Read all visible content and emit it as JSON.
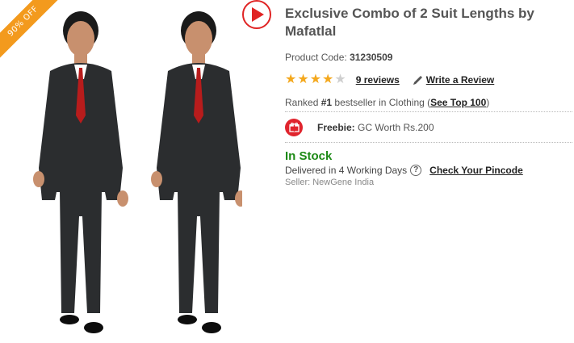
{
  "badge": {
    "discount": "90% OFF"
  },
  "product": {
    "title": "Exclusive Combo of 2 Suit Lengths by Mafatlal",
    "code_label": "Product Code:",
    "code_value": "31230509"
  },
  "rating": {
    "stars": 4,
    "max": 5,
    "reviews_label": "9 reviews",
    "write_label": "Write a Review"
  },
  "rank": {
    "prefix": "Ranked ",
    "number": "#1",
    "middle": " bestseller in Clothing (",
    "link": "See Top 100",
    "suffix": ")"
  },
  "freebie": {
    "label": "Freebie:",
    "text": " GC Worth Rs.200"
  },
  "availability": {
    "status": "In Stock",
    "status_color": "#1d8a16",
    "delivery": "Delivered in 4 Working Days",
    "pincode_link": "Check Your Pincode",
    "seller": "Seller: NewGene India"
  },
  "colors": {
    "accent": "#e02424",
    "ribbon": "#f39a1d",
    "star": "#f4a81d"
  }
}
